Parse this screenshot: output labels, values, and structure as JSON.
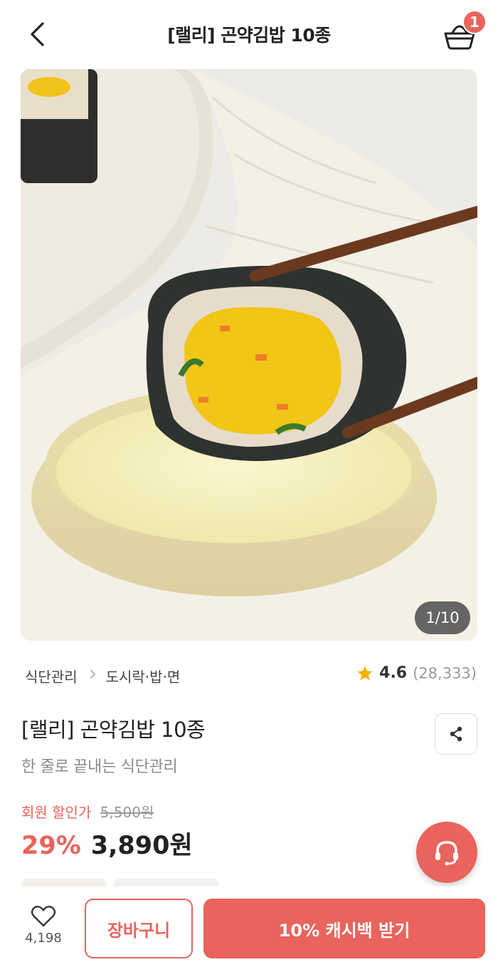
{
  "header": {
    "title": "[랠리] 곤약김밥 10종",
    "cart_badge": "1"
  },
  "gallery": {
    "page_indicator": "1/10",
    "current_page": 1,
    "total_pages": 10
  },
  "breadcrumb": {
    "category": "식단관리",
    "subcategory": "도시락·밥·면"
  },
  "rating": {
    "score": "4.6",
    "count": "(28,333)"
  },
  "product": {
    "name": "[랠리] 곤약김밥 10종",
    "subtitle": "한 줄로 끝내는 식단관리"
  },
  "price": {
    "member_label": "회원 할인가",
    "original": "5,500원",
    "discount": "29%",
    "final": "3,890원"
  },
  "bottom_bar": {
    "wish_count": "4,198",
    "cart_label": "장바구니",
    "cashback_label": "10% 캐시백 받기"
  },
  "colors": {
    "accent": "#e8645c",
    "star": "#f5b301"
  },
  "icons": {
    "back": "chevron-left-icon",
    "cart": "basket-icon",
    "share": "share-icon",
    "star": "star-icon",
    "heart": "heart-icon",
    "help": "headset-icon"
  }
}
